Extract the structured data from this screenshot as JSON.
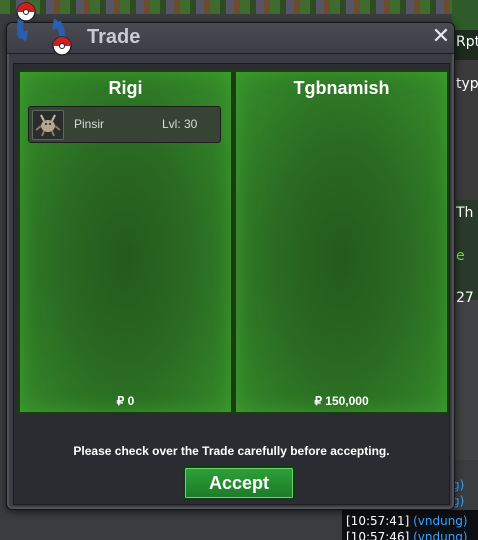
{
  "window": {
    "title": "Trade",
    "close_icon": "close-icon"
  },
  "left_panel": {
    "player": "Rigi",
    "money": "₽ 0",
    "items": [
      {
        "name": "Pinsir",
        "level": "Lvl: 30",
        "icon": "pinsir-sprite-icon"
      }
    ]
  },
  "right_panel": {
    "player": "Tgbnamish",
    "money": "₽ 150,000",
    "items": []
  },
  "notice": "Please check over the Trade carefully before accepting.",
  "accept_label": "Accept",
  "background": {
    "side_texts": [
      "Rpt",
      "typ",
      "Th",
      "e",
      "27"
    ],
    "chat": [
      {
        "time": "[10:57:41]",
        "user": "(vndung)"
      },
      {
        "time": "[10:57:46]",
        "user": "(vndung)"
      }
    ],
    "chat_tail": "g)"
  },
  "colors": {
    "panel_green": "#2a6b22",
    "accept_green": "#2fa03a",
    "window_gray": "#3b3c42"
  }
}
